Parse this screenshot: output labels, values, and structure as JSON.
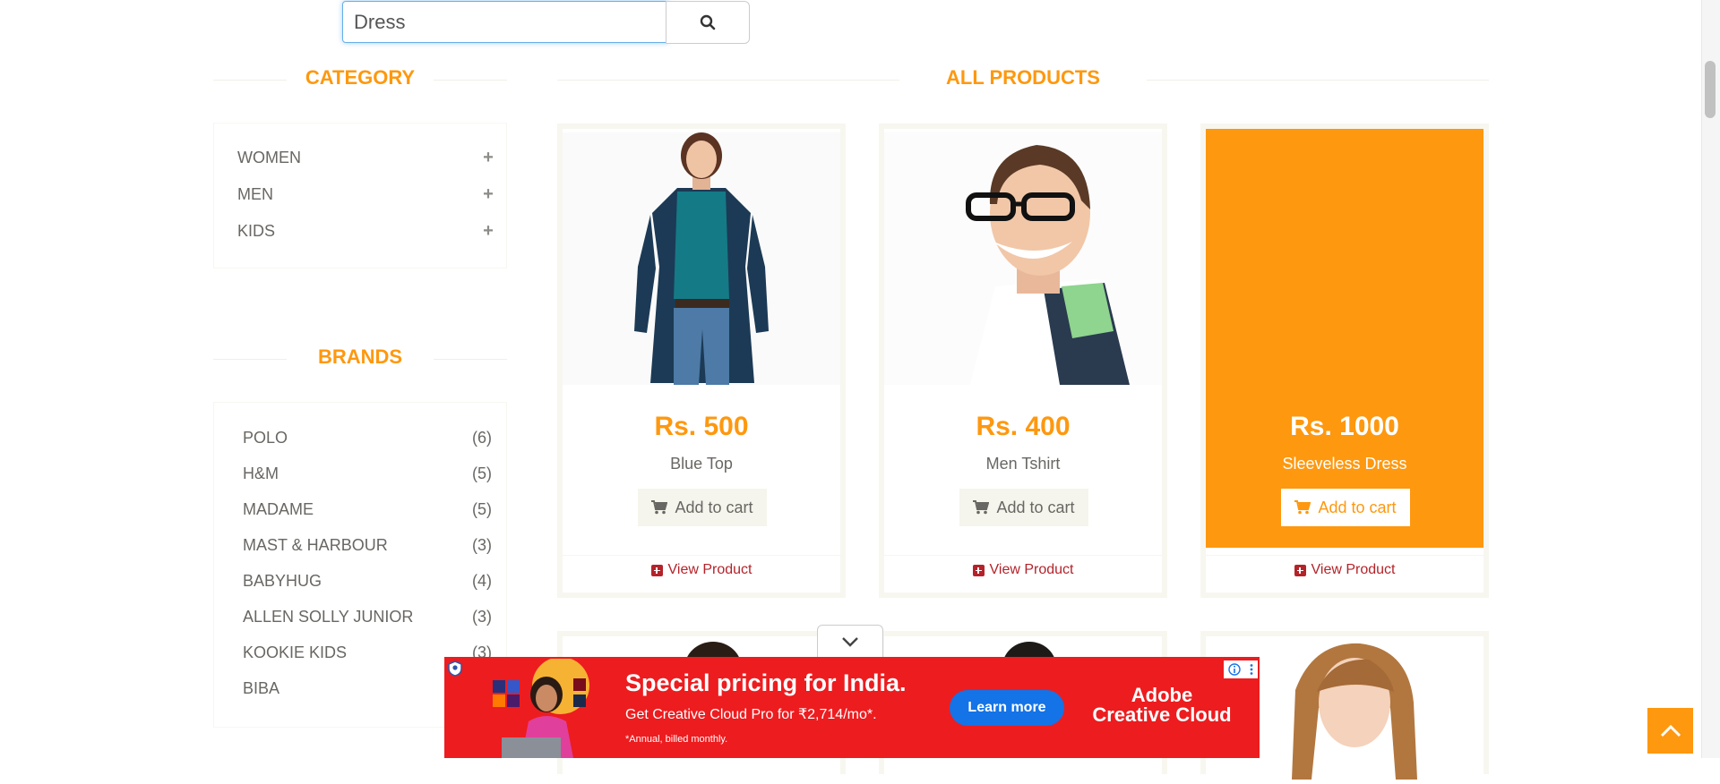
{
  "search": {
    "value": "Dress",
    "button_icon": "search-icon"
  },
  "category": {
    "title": "CATEGORY",
    "items": [
      {
        "label": "WOMEN",
        "icon": "plus-icon"
      },
      {
        "label": "MEN",
        "icon": "plus-icon"
      },
      {
        "label": "KIDS",
        "icon": "plus-icon"
      }
    ]
  },
  "brands": {
    "title": "BRANDS",
    "items": [
      {
        "name": "POLO",
        "count": "(6)"
      },
      {
        "name": "H&M",
        "count": "(5)"
      },
      {
        "name": "MADAME",
        "count": "(5)"
      },
      {
        "name": "MAST & HARBOUR",
        "count": "(3)"
      },
      {
        "name": "BABYHUG",
        "count": "(4)"
      },
      {
        "name": "ALLEN SOLLY JUNIOR",
        "count": "(3)"
      },
      {
        "name": "KOOKIE KIDS",
        "count": "(3)"
      },
      {
        "name": "BIBA",
        "count": ""
      }
    ]
  },
  "products": {
    "title": "ALL PRODUCTS",
    "cart_label": "Add to cart",
    "view_label": "View Product",
    "items": [
      {
        "price": "Rs. 500",
        "name": "Blue Top"
      },
      {
        "price": "Rs. 400",
        "name": "Men Tshirt"
      },
      {
        "price": "Rs. 1000",
        "name": "Sleeveless Dress"
      }
    ]
  },
  "ad": {
    "title": "Special pricing for India.",
    "subtitle": "Get Creative Cloud Pro for ₹2,714/mo*.",
    "note": "*Annual, billed monthly.",
    "cta": "Learn more",
    "brand_line1": "Adobe",
    "brand_line2": "Creative Cloud"
  },
  "colors": {
    "accent": "#FE980F",
    "link": "#B4232A",
    "ad_red": "#ED1C1F",
    "ad_button": "#1473E6"
  }
}
